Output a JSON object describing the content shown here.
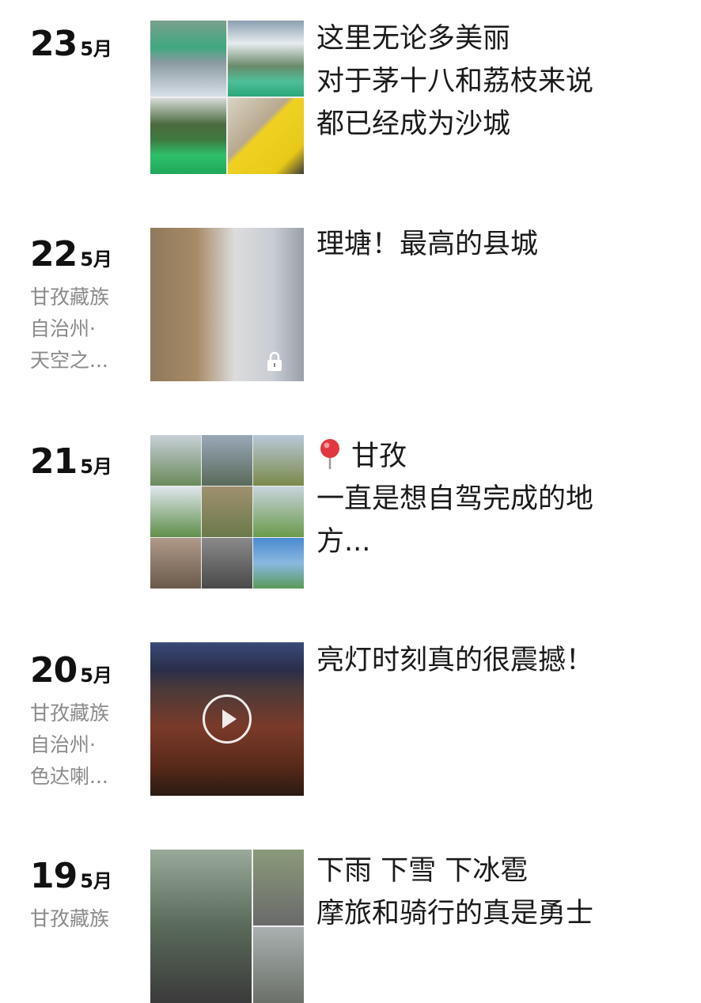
{
  "entries": [
    {
      "day": "23",
      "month": "5月",
      "location_lines": [],
      "media": "4-photo grid",
      "caption_lines": [
        "这里无论多美丽",
        "对于茅十八和荔枝来说",
        "都已经成为沙城"
      ]
    },
    {
      "day": "22",
      "month": "5月",
      "location_lines": [
        "甘孜藏族",
        "自治州·",
        "天空之..."
      ],
      "media": "single photo, locked",
      "caption_lines": [
        "理塘！最高的县城"
      ]
    },
    {
      "day": "21",
      "month": "5月",
      "location_lines": [],
      "media": "9-photo grid",
      "caption_lines": [
        "甘孜",
        "一直是想自驾完成的地",
        "方..."
      ]
    },
    {
      "day": "20",
      "month": "5月",
      "location_lines": [
        "甘孜藏族",
        "自治州·",
        "色达喇..."
      ],
      "media": "video",
      "caption_lines": [
        "亮灯时刻真的很震撼！"
      ]
    },
    {
      "day": "19",
      "month": "5月",
      "location_lines": [
        "甘孜藏族"
      ],
      "media": "3-photo grid",
      "caption_lines": [
        "下雨 下雪 下冰雹",
        "摩旅和骑行的真是勇士"
      ]
    }
  ],
  "icons": {
    "lock": "lock-icon",
    "play": "play-icon",
    "pin": "location-pin-icon"
  },
  "colors": {
    "text": "#1a1a1a",
    "secondary_text": "#8a8a8a",
    "pin_red": "#e0383e"
  }
}
